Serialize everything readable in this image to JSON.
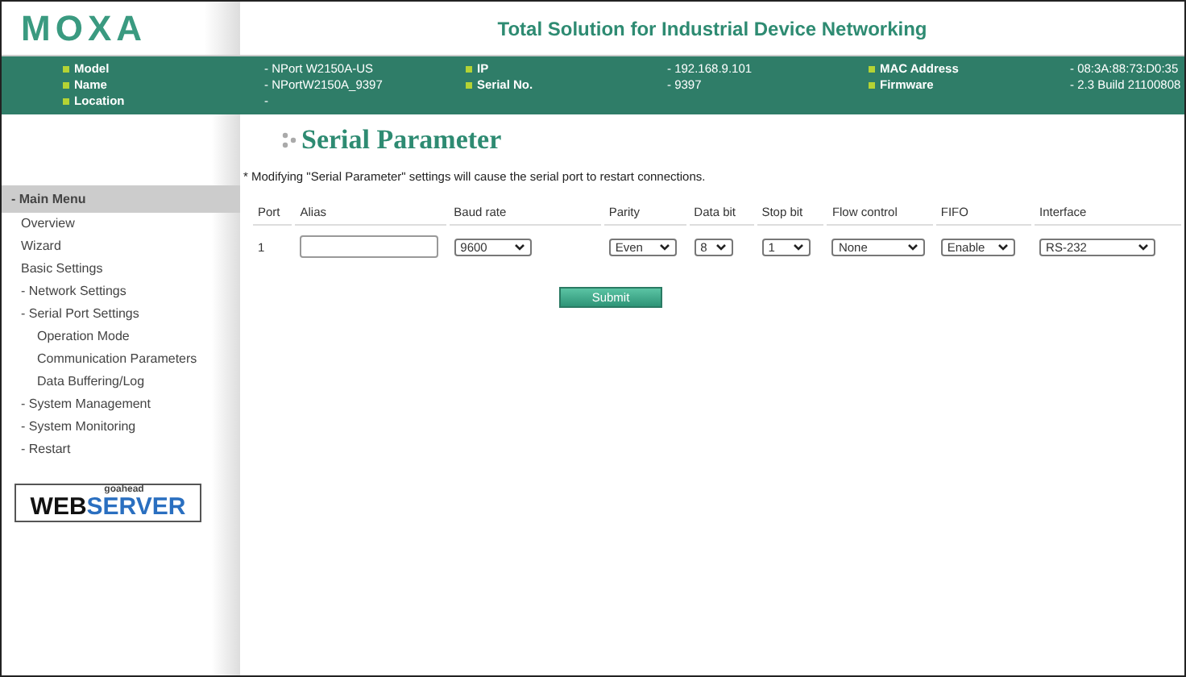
{
  "header": {
    "logo": "MOXA",
    "tagline": "Total Solution for Industrial Device Networking"
  },
  "info": [
    {
      "label": "Model",
      "value": "- NPort W2150A-US"
    },
    {
      "label": "IP",
      "value": "- 192.168.9.101"
    },
    {
      "label": "MAC Address",
      "value": "- 08:3A:88:73:D0:35"
    },
    {
      "label": "Name",
      "value": "- NPortW2150A_9397"
    },
    {
      "label": "Serial No.",
      "value": "- 9397"
    },
    {
      "label": "Firmware",
      "value": "- 2.3 Build 21100808"
    },
    {
      "label": "Location",
      "value": "-"
    }
  ],
  "sidebar": {
    "title": "- Main Menu",
    "items": [
      {
        "label": "Overview"
      },
      {
        "label": "Wizard"
      },
      {
        "label": "Basic Settings"
      },
      {
        "label": "- Network Settings"
      },
      {
        "label": "- Serial Port Settings",
        "children": [
          {
            "label": "Operation Mode"
          },
          {
            "label": "Communication Parameters"
          },
          {
            "label": "Data Buffering/Log"
          }
        ]
      },
      {
        "label": "- System Management"
      },
      {
        "label": "- System Monitoring"
      },
      {
        "label": "- Restart"
      }
    ],
    "badge": {
      "top": "goahead",
      "left": "WEB",
      "right": "SERVER"
    }
  },
  "page": {
    "title": "Serial Parameter",
    "note": "* Modifying \"Serial Parameter\" settings will cause the serial port to restart connections.",
    "columns": [
      "Port",
      "Alias",
      "Baud rate",
      "Parity",
      "Data bit",
      "Stop bit",
      "Flow control",
      "FIFO",
      "Interface"
    ],
    "row": [
      {
        "kind": "text",
        "value": "1"
      },
      {
        "kind": "input"
      },
      {
        "kind": "select",
        "value": "9600"
      },
      {
        "kind": "select",
        "value": "Even"
      },
      {
        "kind": "select",
        "value": "8"
      },
      {
        "kind": "select",
        "value": "1"
      },
      {
        "kind": "select",
        "value": "None"
      },
      {
        "kind": "select",
        "value": "Enable"
      },
      {
        "kind": "select",
        "value": "RS-232"
      }
    ],
    "submit": "Submit"
  }
}
